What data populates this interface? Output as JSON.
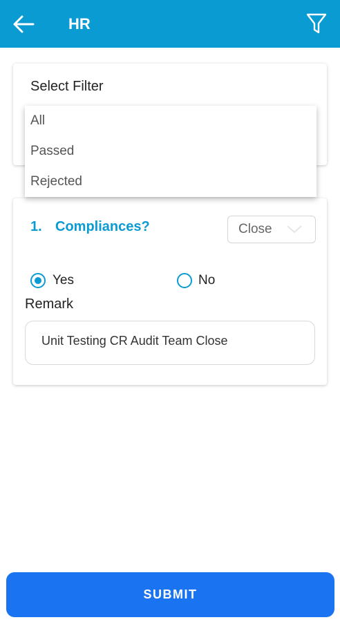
{
  "appbar": {
    "title": "HR",
    "back_icon": "arrow-left-icon",
    "filter_icon": "filter-funnel-icon",
    "color": "#0a9bd3"
  },
  "filter": {
    "title": "Select Filter",
    "options": [
      "All",
      "Passed",
      "Rejected"
    ]
  },
  "question": {
    "number": "1.",
    "text": "Compliances?",
    "status_value": "Close",
    "options": {
      "yes": "Yes",
      "no": "No"
    },
    "selected": "Yes",
    "remark_label": "Remark",
    "remark_value": "Unit Testing CR Audit Team Close"
  },
  "submit": {
    "label": "SUBMIT",
    "color": "#1a73f0"
  }
}
